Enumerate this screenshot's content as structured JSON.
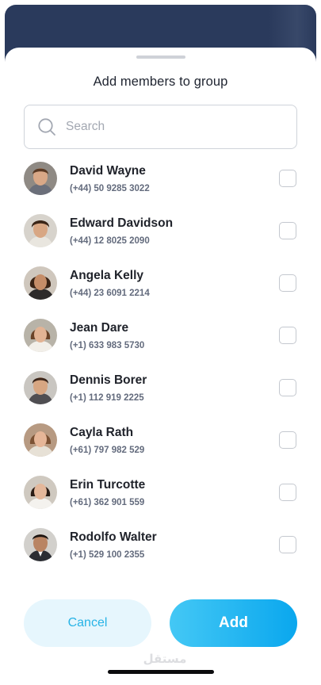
{
  "title": "Add members to group",
  "search": {
    "placeholder": "Search"
  },
  "members": [
    {
      "name": "David Wayne",
      "phone": "(+44) 50 9285 3022",
      "checked": false
    },
    {
      "name": "Edward Davidson",
      "phone": "(+44) 12 8025 2090",
      "checked": false
    },
    {
      "name": "Angela Kelly",
      "phone": "(+44) 23 6091 2214",
      "checked": false
    },
    {
      "name": "Jean Dare",
      "phone": "(+1) 633 983 5730",
      "checked": false
    },
    {
      "name": "Dennis Borer",
      "phone": "(+1) 112 919 2225",
      "checked": false
    },
    {
      "name": "Cayla Rath",
      "phone": "(+61) 797 982 529",
      "checked": false
    },
    {
      "name": "Erin Turcotte",
      "phone": "(+61) 362 901 559",
      "checked": false
    },
    {
      "name": "Rodolfo Walter",
      "phone": "(+1) 529 100 2355",
      "checked": false
    }
  ],
  "buttons": {
    "cancel": "Cancel",
    "add": "Add"
  },
  "watermark": "مستقل",
  "colors": {
    "accent": "#0aa7ee",
    "accent_light": "#e6f6fd",
    "header_bg": "#2a3a5c"
  },
  "icons": {
    "search": "search-icon",
    "checkbox": "checkbox-icon"
  }
}
